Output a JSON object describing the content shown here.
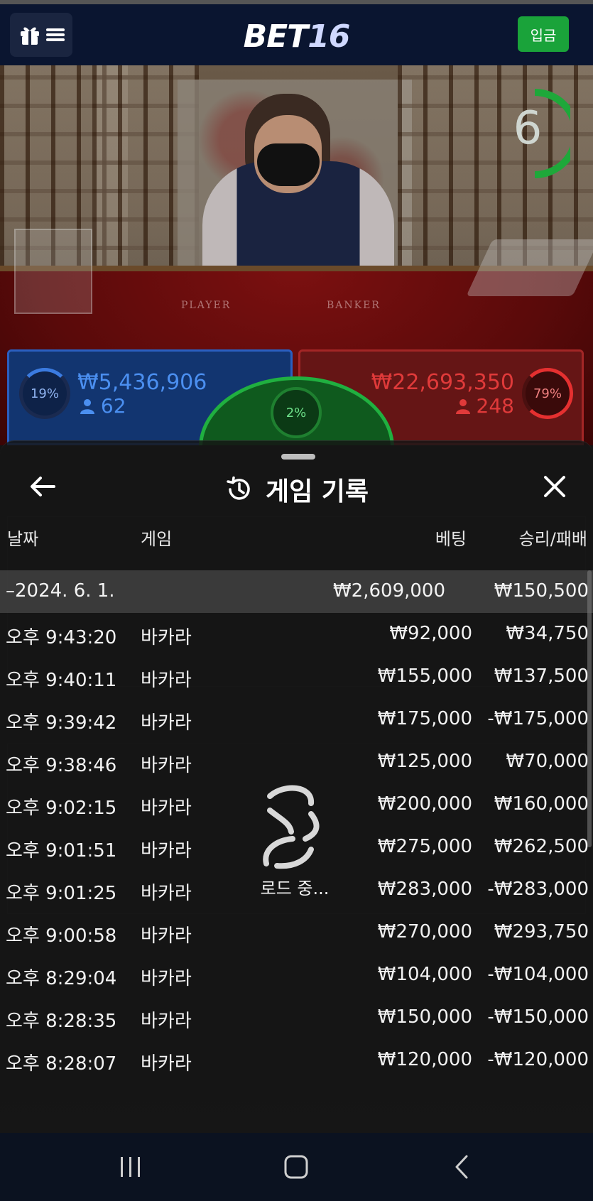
{
  "header": {
    "logo_main": "BET",
    "logo_num": "16",
    "deposit_label": "입금"
  },
  "video": {
    "timer_value": "6",
    "table_player_text": "PLAYER",
    "table_banker_text": "BANKER"
  },
  "bets": {
    "player": {
      "percent": "19%",
      "amount": "₩5,436,906",
      "count": "62"
    },
    "tie": {
      "percent": "2%"
    },
    "banker": {
      "percent": "79%",
      "amount": "₩22,693,350",
      "count": "248"
    }
  },
  "modal": {
    "title": "게임 기록",
    "columns": {
      "date": "날짜",
      "game": "게임",
      "bet": "베팅",
      "result": "승리/패배"
    },
    "summary": {
      "date": "–2024. 6. 1.",
      "bet": "₩2,609,000",
      "result": "₩150,500"
    },
    "rows": [
      {
        "time": "오후 9:43:20",
        "game": "바카라",
        "bet": "₩92,000",
        "result": "₩34,750"
      },
      {
        "time": "오후 9:40:11",
        "game": "바카라",
        "bet": "₩155,000",
        "result": "₩137,500"
      },
      {
        "time": "오후 9:39:42",
        "game": "바카라",
        "bet": "₩175,000",
        "result": "-₩175,000"
      },
      {
        "time": "오후 9:38:46",
        "game": "바카라",
        "bet": "₩125,000",
        "result": "₩70,000"
      },
      {
        "time": "오후 9:02:15",
        "game": "바카라",
        "bet": "₩200,000",
        "result": "₩160,000"
      },
      {
        "time": "오후 9:01:51",
        "game": "바카라",
        "bet": "₩275,000",
        "result": "₩262,500"
      },
      {
        "time": "오후 9:01:25",
        "game": "바카라",
        "bet": "₩283,000",
        "result": "-₩283,000"
      },
      {
        "time": "오후 9:00:58",
        "game": "바카라",
        "bet": "₩270,000",
        "result": "₩293,750"
      },
      {
        "time": "오후 8:29:04",
        "game": "바카라",
        "bet": "₩104,000",
        "result": "-₩104,000"
      },
      {
        "time": "오후 8:28:35",
        "game": "바카라",
        "bet": "₩150,000",
        "result": "-₩150,000"
      },
      {
        "time": "오후 8:28:07",
        "game": "바카라",
        "bet": "₩120,000",
        "result": "-₩120,000"
      }
    ],
    "loading_text": "로드 중..."
  },
  "colors": {
    "accent_green": "#1aa33a",
    "player_blue": "#4b8ff0",
    "banker_red": "#e03a3a"
  },
  "icons": {
    "menu": "gift-menu-icon",
    "back": "arrow-left-icon",
    "history": "history-icon",
    "close": "close-icon",
    "loader": "spinner-icon",
    "nav_recents": "recents-icon",
    "nav_home": "home-icon",
    "nav_back": "nav-back-icon"
  }
}
